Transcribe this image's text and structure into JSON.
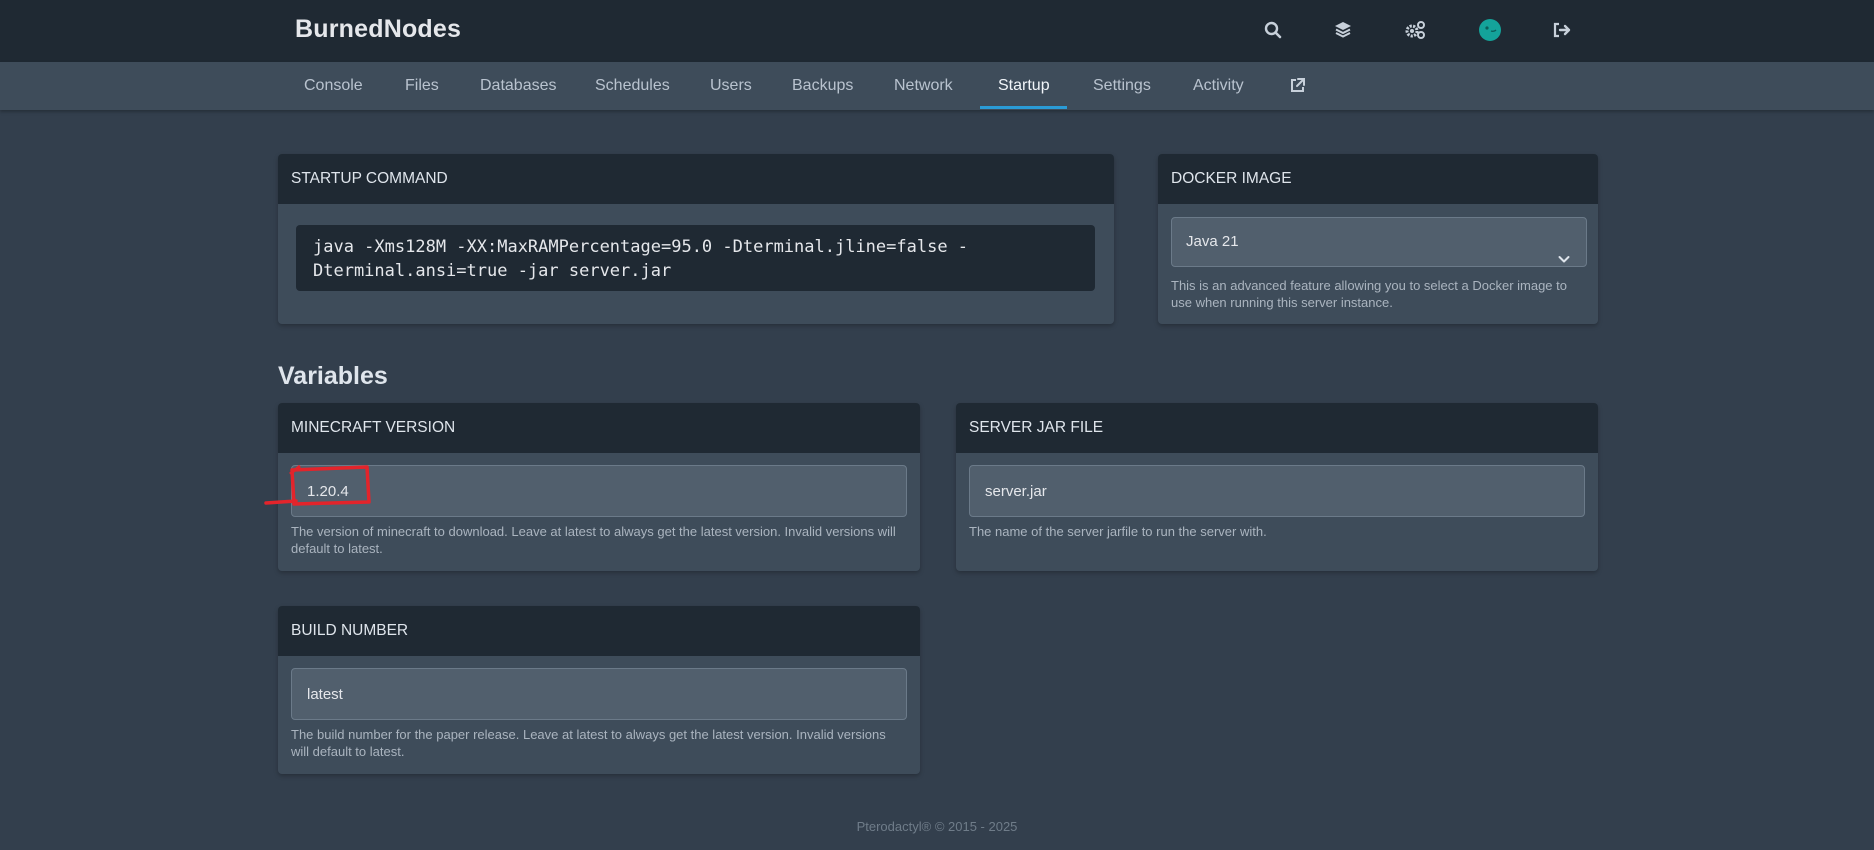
{
  "header": {
    "brand": "BurnedNodes",
    "icons": [
      "search-icon",
      "layers-icon",
      "cogs-icon",
      "avatar",
      "logout-icon"
    ]
  },
  "nav": {
    "tabs": [
      {
        "label": "Console"
      },
      {
        "label": "Files"
      },
      {
        "label": "Databases"
      },
      {
        "label": "Schedules"
      },
      {
        "label": "Users"
      },
      {
        "label": "Backups"
      },
      {
        "label": "Network"
      },
      {
        "label": "Startup",
        "active": true
      },
      {
        "label": "Settings"
      },
      {
        "label": "Activity"
      }
    ],
    "external_icon": "external-link-icon"
  },
  "startup": {
    "title": "STARTUP COMMAND",
    "command": "java -Xms128M -XX:MaxRAMPercentage=95.0 -Dterminal.jline=false -\nDterminal.ansi=true -jar server.jar"
  },
  "docker": {
    "title": "DOCKER IMAGE",
    "selected": "Java 21",
    "help": "This is an advanced feature allowing you to select a Docker image to use when running this server instance."
  },
  "variables": {
    "title": "Variables",
    "minecraft_version": {
      "title": "MINECRAFT VERSION",
      "value": "1.20.4",
      "help": "The version of minecraft to download. Leave at latest to always get the latest version. Invalid versions will default to latest."
    },
    "server_jar": {
      "title": "SERVER JAR FILE",
      "value": "server.jar",
      "help": "The name of the server jarfile to run the server with."
    },
    "build_number": {
      "title": "BUILD NUMBER",
      "value": "latest",
      "help": "The build number for the paper release. Leave at latest to always get the latest version. Invalid versions will default to latest."
    }
  },
  "footer": {
    "text": "Pterodactyl® © 2015 - 2025"
  },
  "colors": {
    "accent": "#2a9bd6",
    "annotation": "#e3242b",
    "header_bg": "#1f2933",
    "page_bg": "#333f4d"
  }
}
